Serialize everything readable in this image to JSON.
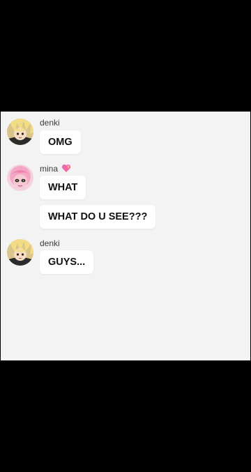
{
  "messages": [
    {
      "sender": "denki",
      "text": "OMG"
    },
    {
      "sender": "mina",
      "sender_emoji": "heart-emoji",
      "text": "WHAT"
    },
    {
      "text": "WHAT DO U SEE???"
    },
    {
      "sender": "denki",
      "text": "GUYS..."
    }
  ],
  "colors": {
    "background": "#000000",
    "chat_background": "#f3f3f3",
    "bubble": "#ffffff",
    "heart": "#f06aa8"
  }
}
